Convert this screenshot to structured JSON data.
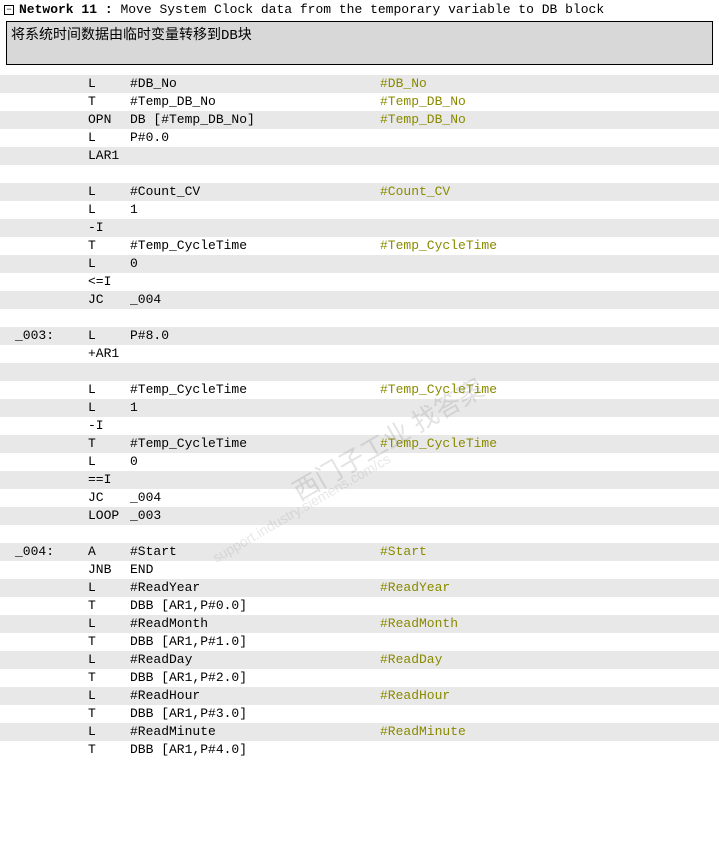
{
  "header": {
    "collapse_glyph": "−",
    "title_prefix": "Network 11 :",
    "title_desc": "Move System Clock data from the temporary variable to DB block"
  },
  "comment": "将系统时间数据由临时变量转移到DB块",
  "watermark": {
    "main": "西门子工业    找答案",
    "sub": "support.industry.siemens.com/cs"
  },
  "code_rows": [
    {
      "shaded": true,
      "label": "",
      "mn": "L",
      "op": "#DB_No",
      "cm": "#DB_No"
    },
    {
      "shaded": false,
      "label": "",
      "mn": "T",
      "op": "#Temp_DB_No",
      "cm": "#Temp_DB_No"
    },
    {
      "shaded": true,
      "label": "",
      "mn": "OPN",
      "op": "DB [#Temp_DB_No]",
      "cm": "#Temp_DB_No"
    },
    {
      "shaded": false,
      "label": "",
      "mn": "L",
      "op": "P#0.0",
      "cm": ""
    },
    {
      "shaded": true,
      "label": "",
      "mn": "LAR1",
      "op": "",
      "cm": ""
    },
    {
      "shaded": false,
      "label": "",
      "mn": "",
      "op": "",
      "cm": ""
    },
    {
      "shaded": true,
      "label": "",
      "mn": "L",
      "op": "#Count_CV",
      "cm": "#Count_CV"
    },
    {
      "shaded": false,
      "label": "",
      "mn": "L",
      "op": "1",
      "cm": ""
    },
    {
      "shaded": true,
      "label": "",
      "mn": "-I",
      "op": "",
      "cm": ""
    },
    {
      "shaded": false,
      "label": "",
      "mn": "T",
      "op": "#Temp_CycleTime",
      "cm": "#Temp_CycleTime"
    },
    {
      "shaded": true,
      "label": "",
      "mn": "L",
      "op": "0",
      "cm": ""
    },
    {
      "shaded": false,
      "label": "",
      "mn": "<=I",
      "op": "",
      "cm": ""
    },
    {
      "shaded": true,
      "label": "",
      "mn": "JC",
      "op": "_004",
      "cm": ""
    },
    {
      "shaded": false,
      "label": "",
      "mn": "",
      "op": "",
      "cm": ""
    },
    {
      "shaded": true,
      "label": "_003:",
      "mn": "L",
      "op": "P#8.0",
      "cm": ""
    },
    {
      "shaded": false,
      "label": "",
      "mn": "+AR1",
      "op": "",
      "cm": ""
    },
    {
      "shaded": true,
      "label": "",
      "mn": "",
      "op": "",
      "cm": ""
    },
    {
      "shaded": false,
      "label": "",
      "mn": "L",
      "op": "#Temp_CycleTime",
      "cm": "#Temp_CycleTime"
    },
    {
      "shaded": true,
      "label": "",
      "mn": "L",
      "op": "1",
      "cm": ""
    },
    {
      "shaded": false,
      "label": "",
      "mn": "-I",
      "op": "",
      "cm": ""
    },
    {
      "shaded": true,
      "label": "",
      "mn": "T",
      "op": "#Temp_CycleTime",
      "cm": "#Temp_CycleTime"
    },
    {
      "shaded": false,
      "label": "",
      "mn": "L",
      "op": "0",
      "cm": ""
    },
    {
      "shaded": true,
      "label": "",
      "mn": "==I",
      "op": "",
      "cm": ""
    },
    {
      "shaded": false,
      "label": "",
      "mn": "JC",
      "op": "_004",
      "cm": ""
    },
    {
      "shaded": true,
      "label": "",
      "mn": "LOOP",
      "op": "_003",
      "cm": ""
    },
    {
      "shaded": false,
      "label": "",
      "mn": "",
      "op": "",
      "cm": ""
    },
    {
      "shaded": true,
      "label": "_004:",
      "mn": "A",
      "op": "#Start",
      "cm": "#Start"
    },
    {
      "shaded": false,
      "label": "",
      "mn": "JNB",
      "op": "END",
      "cm": ""
    },
    {
      "shaded": true,
      "label": "",
      "mn": "L",
      "op": "#ReadYear",
      "cm": "#ReadYear"
    },
    {
      "shaded": false,
      "label": "",
      "mn": "T",
      "op": "DBB [AR1,P#0.0]",
      "cm": ""
    },
    {
      "shaded": true,
      "label": "",
      "mn": "L",
      "op": "#ReadMonth",
      "cm": "#ReadMonth"
    },
    {
      "shaded": false,
      "label": "",
      "mn": "T",
      "op": "DBB [AR1,P#1.0]",
      "cm": ""
    },
    {
      "shaded": true,
      "label": "",
      "mn": "L",
      "op": "#ReadDay",
      "cm": "#ReadDay"
    },
    {
      "shaded": false,
      "label": "",
      "mn": "T",
      "op": "DBB [AR1,P#2.0]",
      "cm": ""
    },
    {
      "shaded": true,
      "label": "",
      "mn": "L",
      "op": "#ReadHour",
      "cm": "#ReadHour"
    },
    {
      "shaded": false,
      "label": "",
      "mn": "T",
      "op": "DBB [AR1,P#3.0]",
      "cm": ""
    },
    {
      "shaded": true,
      "label": "",
      "mn": "L",
      "op": "#ReadMinute",
      "cm": "#ReadMinute"
    },
    {
      "shaded": false,
      "label": "",
      "mn": "T",
      "op": "DBB [AR1,P#4.0]",
      "cm": ""
    }
  ]
}
